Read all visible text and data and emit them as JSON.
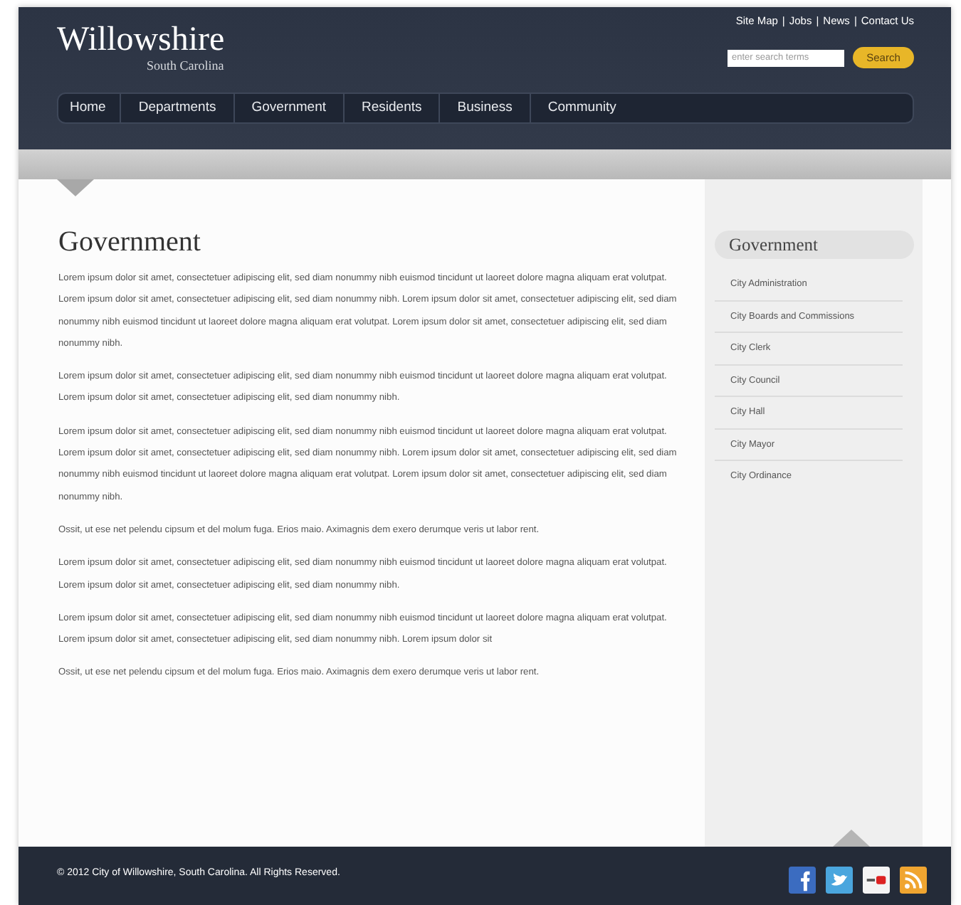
{
  "header": {
    "logo": "Willowshire",
    "tagline": "South Carolina",
    "top_links": [
      "Site Map",
      "Jobs",
      "News",
      "Contact Us"
    ],
    "link_separator": "|",
    "search": {
      "placeholder": "enter search terms",
      "button": "Search"
    }
  },
  "nav": [
    {
      "label": "Home",
      "selected": false
    },
    {
      "label": "Departments",
      "selected": false
    },
    {
      "label": "Government",
      "selected": false
    },
    {
      "label": "Residents",
      "selected": false
    },
    {
      "label": "Business",
      "selected": false
    },
    {
      "label": "Community",
      "selected": false
    }
  ],
  "main": {
    "title": "Government",
    "paragraphs": [
      "Lorem ipsum dolor sit amet, consectetuer adipiscing elit, sed diam nonummy nibh euismod tincidunt ut laoreet dolore magna aliquam erat volutpat. Lorem ipsum dolor sit amet, consectetuer adipiscing elit, sed diam nonummy nibh. Lorem ipsum dolor sit amet, consectetuer adipiscing elit, sed diam nonummy nibh euismod tincidunt ut laoreet dolore magna aliquam erat volutpat. Lorem ipsum dolor sit amet, consectetuer adipiscing elit, sed diam nonummy nibh.",
      "Lorem ipsum dolor sit amet, consectetuer adipiscing elit, sed diam nonummy nibh euismod tincidunt ut laoreet dolore magna aliquam erat volutpat. Lorem ipsum dolor sit amet, consectetuer adipiscing elit, sed diam nonummy nibh.",
      "Lorem ipsum dolor sit amet, consectetuer adipiscing elit, sed diam nonummy nibh euismod tincidunt ut laoreet dolore magna aliquam erat volutpat. Lorem ipsum dolor sit amet, consectetuer adipiscing elit, sed diam nonummy nibh. Lorem ipsum dolor sit amet, consectetuer adipiscing elit, sed diam nonummy nibh euismod tincidunt ut laoreet dolore magna aliquam erat volutpat. Lorem ipsum dolor sit amet, consectetuer adipiscing elit, sed diam nonummy nibh.",
      "Ossit, ut ese net pelendu cipsum et del molum fuga. Erios maio. Aximagnis dem exero derumque veris ut labor rent.",
      "Lorem ipsum dolor sit amet, consectetuer adipiscing elit, sed diam nonummy nibh euismod tincidunt ut laoreet dolore magna aliquam erat volutpat. Lorem ipsum dolor sit amet, consectetuer adipiscing elit, sed diam nonummy nibh.",
      "Lorem ipsum dolor sit amet, consectetuer adipiscing elit, sed diam nonummy nibh euismod tincidunt ut laoreet dolore magna aliquam erat volutpat. Lorem ipsum dolor sit amet, consectetuer adipiscing elit, sed diam nonummy nibh. Lorem ipsum dolor sit",
      "Ossit, ut ese net pelendu cipsum et del molum fuga. Erios maio. Aximagnis dem exero derumque veris ut labor rent."
    ]
  },
  "sidebar": {
    "title": "Government",
    "items": [
      "City Administration",
      "City Boards and Commissions",
      "City Clerk",
      "City Council",
      "City Hall",
      "City Mayor",
      "City Ordinance"
    ]
  },
  "footer": {
    "copyright": "© 2012 City of Willowshire, South Carolina. All Rights Reserved.",
    "social": [
      {
        "kind": "facebook"
      },
      {
        "kind": "twitter"
      },
      {
        "kind": "video"
      },
      {
        "kind": "rss"
      }
    ]
  }
}
